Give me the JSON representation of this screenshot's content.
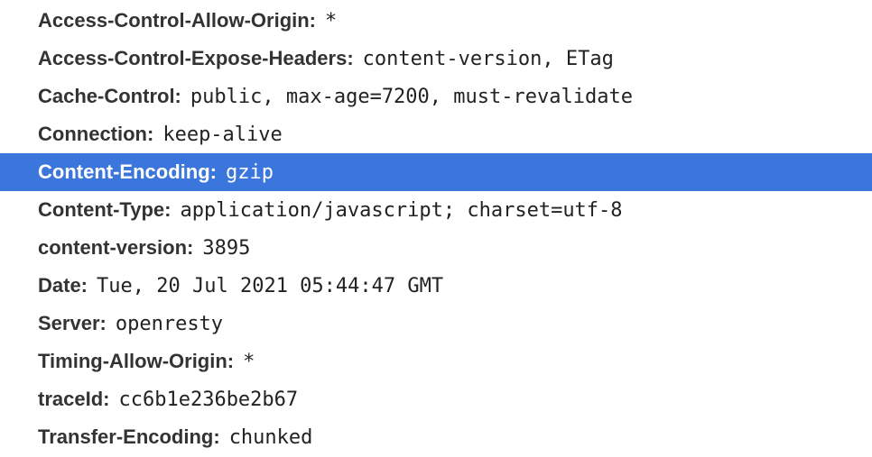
{
  "headers": [
    {
      "name": "Access-Control-Allow-Origin:",
      "value": "*"
    },
    {
      "name": "Access-Control-Expose-Headers:",
      "value": "content-version, ETag"
    },
    {
      "name": "Cache-Control:",
      "value": "public, max-age=7200, must-revalidate"
    },
    {
      "name": "Connection:",
      "value": "keep-alive"
    },
    {
      "name": "Content-Encoding:",
      "value": "gzip"
    },
    {
      "name": "Content-Type:",
      "value": "application/javascript; charset=utf-8"
    },
    {
      "name": "content-version:",
      "value": "3895"
    },
    {
      "name": "Date:",
      "value": "Tue, 20 Jul 2021 05:44:47 GMT"
    },
    {
      "name": "Server:",
      "value": "openresty"
    },
    {
      "name": "Timing-Allow-Origin:",
      "value": "*"
    },
    {
      "name": "traceId:",
      "value": "cc6b1e236be2b67"
    },
    {
      "name": "Transfer-Encoding:",
      "value": "chunked"
    }
  ],
  "colors": {
    "selection": "#3b76dd"
  }
}
